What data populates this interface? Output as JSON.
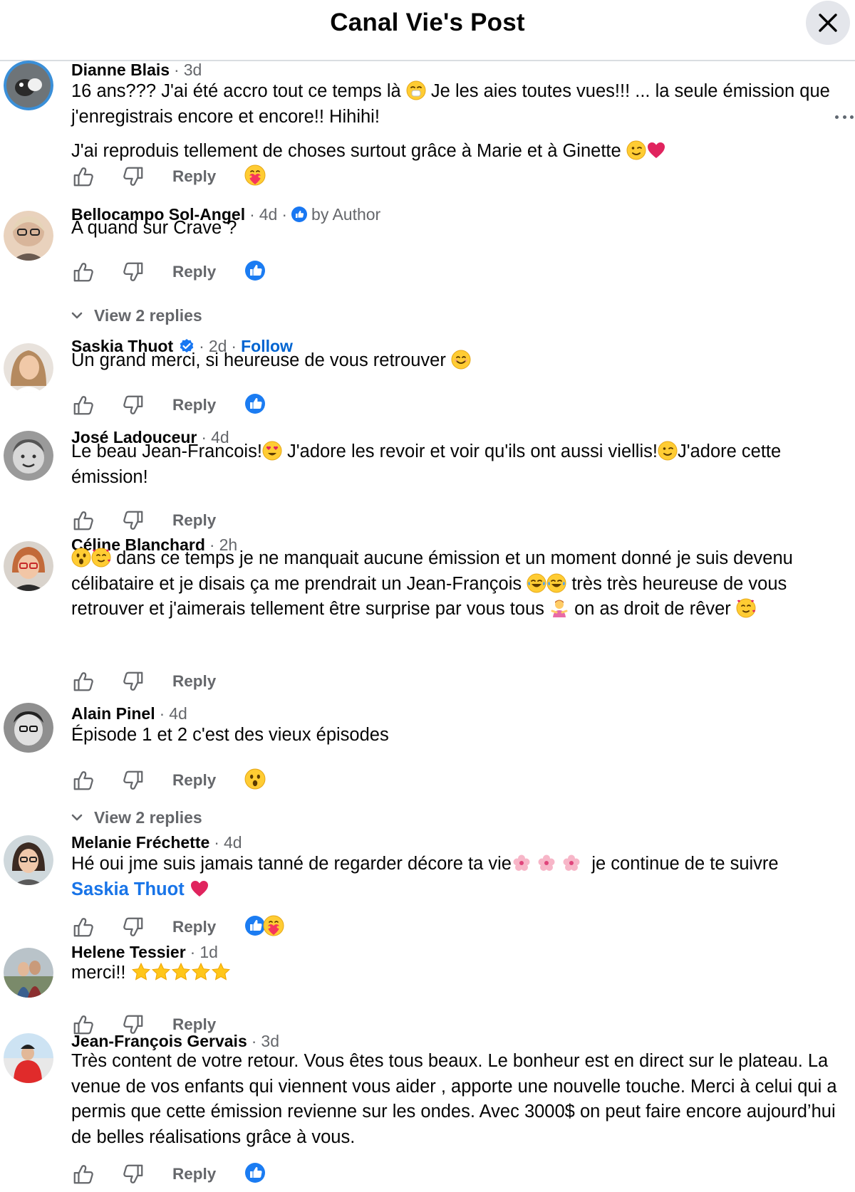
{
  "header": {
    "title": "Canal Vie's Post"
  },
  "comments": [
    {
      "author": "Dianne Blais",
      "time": "3d",
      "lines": [
        "16 ans??? J'ai été accro tout ce temps là",
        "Je les aies toutes vues!!! ... la seule émission que j'enregistrais encore et encore!! Hihihi!",
        "J'ai reproduis tellement de choses surtout grâce à Marie et à Ginette"
      ],
      "reply_label": "Reply",
      "reaction": "care-reaction-icon"
    },
    {
      "author": "Bellocampo Sol-Angel",
      "time": "4d",
      "author_badge": "by Author",
      "lines": [
        "A quand sur Crave ?"
      ],
      "reply_label": "Reply",
      "reaction": "like-reaction-icon",
      "view_replies": "View 2 replies"
    },
    {
      "author": "Saskia Thuot",
      "time": "2d",
      "follow_label": "Follow",
      "lines": [
        "Un grand merci, si heureuse de vous retrouver"
      ],
      "reply_label": "Reply",
      "reaction": "like-reaction-icon"
    },
    {
      "author": "José Ladouceur",
      "time": "4d",
      "lines": [
        "Le beau Jean-Francois!",
        "J'adore les revoir et voir qu'ils ont aussi viellis!",
        "J'adore cette émission!"
      ],
      "reply_label": "Reply"
    },
    {
      "author": "Céline Blanchard",
      "time": "2h",
      "lines": [
        "dans ce temps je ne manquait aucune émission et un moment donné je suis devenu célibataire et je disais ça me prendrait un Jean-François",
        "très très heureuse de vous retrouver et j'aimerais tellement être surprise par vous tous",
        "on as droit de rêver"
      ],
      "reply_label": "Reply"
    },
    {
      "author": "Alain Pinel",
      "time": "4d",
      "lines": [
        "Épisode 1 et 2 c'est des vieux épisodes"
      ],
      "reply_label": "Reply",
      "reaction": "wow-reaction-icon",
      "view_replies": "View 2 replies"
    },
    {
      "author": "Melanie Fréchette",
      "time": "4d",
      "lines": [
        "Hé oui jme suis jamais tanné de regarder décore ta vie",
        "je continue de te suivre"
      ],
      "mention": "Saskia Thuot",
      "reply_label": "Reply",
      "reaction": "like-care-reaction-icons"
    },
    {
      "author": "Helene Tessier",
      "time": "1d",
      "lines": [
        "merci!!"
      ],
      "reply_label": "Reply"
    },
    {
      "author": "Jean-François Gervais",
      "time": "3d",
      "lines": [
        "Très content de votre retour. Vous êtes tous beaux. Le bonheur est en direct sur le plateau. La venue de vos enfants qui viennent vous aider , apporte une nouvelle touche. Merci à celui qui a permis que cette émission revienne sur les ondes. Avec 3000$ on peut faire encore aujourd’hui de belles réalisations grâce à vous."
      ],
      "reply_label": "Reply",
      "reaction": "like-reaction-icon"
    }
  ],
  "colors": {
    "accent": "#1877f2",
    "link": "#0064d1",
    "muted": "#65676b",
    "divider": "#dadde1"
  }
}
